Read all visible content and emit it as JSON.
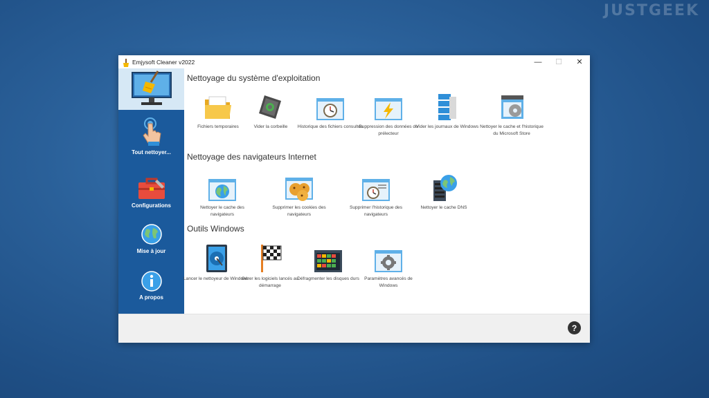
{
  "watermark": "JUSTGEEK",
  "window": {
    "title": "Emjysoft Cleaner v2022",
    "controls": {
      "minimize": "—",
      "maximize": "☐",
      "close": "✕"
    }
  },
  "sidebar": {
    "items": [
      {
        "label": "Tout nettoyer..."
      },
      {
        "label": "Configurations"
      },
      {
        "label": "Mise à jour"
      },
      {
        "label": "A propos"
      }
    ]
  },
  "sections": [
    {
      "title": "Nettoyage du système d'exploitation",
      "tools": [
        {
          "label": "Fichiers temporaires",
          "icon": "folder-icon"
        },
        {
          "label": "Vider la corbeille",
          "icon": "recycle-bin-icon"
        },
        {
          "label": "Historique des fichiers consultés",
          "icon": "clock-window-icon"
        },
        {
          "label": "Suppression des données du prélecteur",
          "icon": "lightning-window-icon"
        },
        {
          "label": "Vider les journaux de Windows",
          "icon": "logs-icon"
        },
        {
          "label": "Nettoyer le cache et l'historique du Microsoft Store",
          "icon": "store-cache-icon"
        }
      ]
    },
    {
      "title": "Nettoyage des navigateurs Internet",
      "tools": [
        {
          "label": "Nettoyer le cache des navigateurs",
          "icon": "globe-window-icon"
        },
        {
          "label": "Supprimer les cookies des navigateurs",
          "icon": "cookies-icon"
        },
        {
          "label": "Supprimer l'historique des navigateurs",
          "icon": "history-window-icon"
        },
        {
          "label": "Nettoyer le cache DNS",
          "icon": "dns-server-icon"
        }
      ]
    },
    {
      "title": "Outils Windows",
      "tools": [
        {
          "label": "Lancer le nettoyeur de Windows",
          "icon": "disk-cleaner-icon"
        },
        {
          "label": "Gérer les logiciels lancés au démarrage",
          "icon": "checkered-flag-icon"
        },
        {
          "label": "Défragmenter les disques durs",
          "icon": "defrag-icon"
        },
        {
          "label": "Paramètres avancés de Windows",
          "icon": "gear-window-icon"
        }
      ]
    }
  ],
  "footer": {
    "help": "?"
  },
  "colors": {
    "sidebar": "#1b5a9c",
    "accent": "#2f8fd8",
    "background": "#2a6099"
  }
}
